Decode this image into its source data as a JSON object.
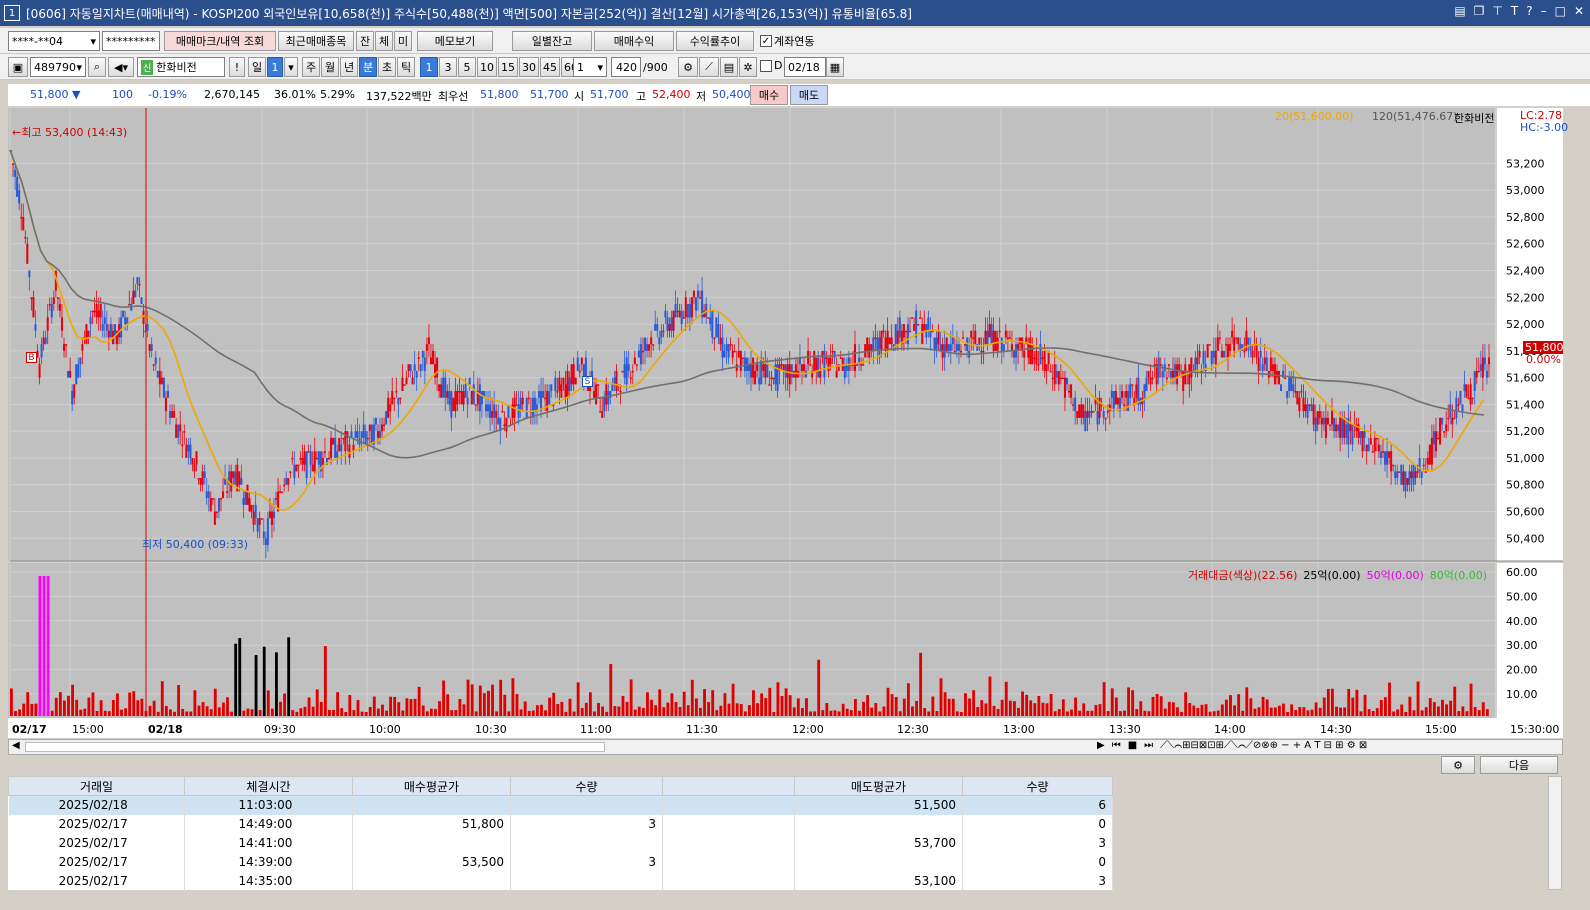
{
  "title": {
    "num": "1",
    "text": "[0606] 자동일지차트(매매내역) - KOSPI200 외국인보유[10,658(천)] 주식수[50,488(천)] 액면[500] 자본금[252(억)] 결산[12월] 시가총액[26,153(억)] 유통비율[65.8]"
  },
  "toolbar1": {
    "account": "****-**04",
    "password": "*********",
    "mark_btn": "매매마크/내역 조회",
    "recent_btn": "최근매매종목",
    "j": "잔",
    "c": "체",
    "m": "미",
    "memo_btn": "메모보기",
    "daily_btn": "일별잔고",
    "profit_btn": "매매수익",
    "rate_btn": "수익률추이",
    "link_label": "계좌연동"
  },
  "toolbar2": {
    "code": "489790",
    "name": "한화비전",
    "shin": "신",
    "excl": "!",
    "period_day": "일",
    "period_val": "1",
    "week": "주",
    "month": "월",
    "year": "년",
    "minute": "분",
    "sec": "초",
    "tick": "틱",
    "ints": [
      "1",
      "3",
      "5",
      "10",
      "15",
      "30",
      "45",
      "60"
    ],
    "custom": "1",
    "count": "420",
    "total": "/900",
    "date_flag": "D",
    "date": "02/18"
  },
  "quote": {
    "price": "51,800",
    "arrow": "▼",
    "change": "100",
    "pct": "-0.19%",
    "volume": "2,670,145",
    "vol_ratio": "36.01%",
    "turnover": "5.29%",
    "amount": "137,522백만",
    "ask_label": "최우선",
    "ask": "51,800",
    "bid": "51,700",
    "open_label": "시",
    "open": "51,700",
    "high_label": "고",
    "high": "52,400",
    "low_label": "저",
    "low": "50,400",
    "buy": "매수",
    "sell": "매도"
  },
  "chart": {
    "high_label": "←최고 53,400 (14:43)",
    "low_label": "최저 50,400 (09:33)",
    "legend_ma20": "20(51,600.00)",
    "legend_ma120": "120(51,476.67)",
    "legend_name": "한화비전",
    "lc": "LC:2.78",
    "hc": "HC:-3.00",
    "cur_price": "51,800",
    "cur_pct": "0.00%",
    "b_mark": "B",
    "s_mark": "S",
    "price_ticks": [
      "53,200",
      "53,000",
      "52,800",
      "52,600",
      "52,400",
      "52,200",
      "52,000",
      "51,800",
      "51,600",
      "51,400",
      "51,200",
      "51,000",
      "50,800",
      "50,600",
      "50,400"
    ],
    "vol_legend": {
      "a": "거래대금(색상)(22.56)",
      "b": "25억(0.00)",
      "c": "50억(0.00)",
      "d": "80억(0.00)"
    },
    "vol_ticks": [
      "60.00",
      "50.00",
      "40.00",
      "30.00",
      "20.00",
      "10.00"
    ],
    "x_labels": [
      "02/17",
      "15:00",
      "02/18",
      "09:30",
      "10:00",
      "10:30",
      "11:00",
      "11:30",
      "12:00",
      "12:30",
      "13:00",
      "13:30",
      "14:00",
      "14:30",
      "15:00"
    ],
    "x_end": "15:30:00",
    "colors": {
      "up": "#e8000e",
      "down": "#2a5bd7",
      "ma20": "#f0a800",
      "ma120": "#707070",
      "magenta": "#ff00ff"
    }
  },
  "chart_data": {
    "type": "candlestick",
    "series": [
      {
        "name": "20",
        "last": 51600.0
      },
      {
        "name": "120",
        "last": 51476.67
      }
    ],
    "high": {
      "price": 53400,
      "time": "14:43"
    },
    "low": {
      "price": 50400,
      "time": "09:33"
    },
    "ylim": [
      50300,
      53400
    ]
  },
  "next_btn": "다음",
  "table": {
    "headers": [
      "거래일",
      "체결시간",
      "매수평균가",
      "수량",
      "",
      "매도평균가",
      "수량"
    ],
    "rows": [
      [
        "2025/02/18",
        "11:03:00",
        "",
        "",
        "",
        "51,500",
        "6"
      ],
      [
        "2025/02/17",
        "14:49:00",
        "51,800",
        "3",
        "",
        "",
        "0"
      ],
      [
        "2025/02/17",
        "14:41:00",
        "",
        "",
        "",
        "53,700",
        "3"
      ],
      [
        "2025/02/17",
        "14:39:00",
        "53,500",
        "3",
        "",
        "",
        "0"
      ],
      [
        "2025/02/17",
        "14:35:00",
        "",
        "",
        "",
        "53,100",
        "3"
      ]
    ]
  }
}
